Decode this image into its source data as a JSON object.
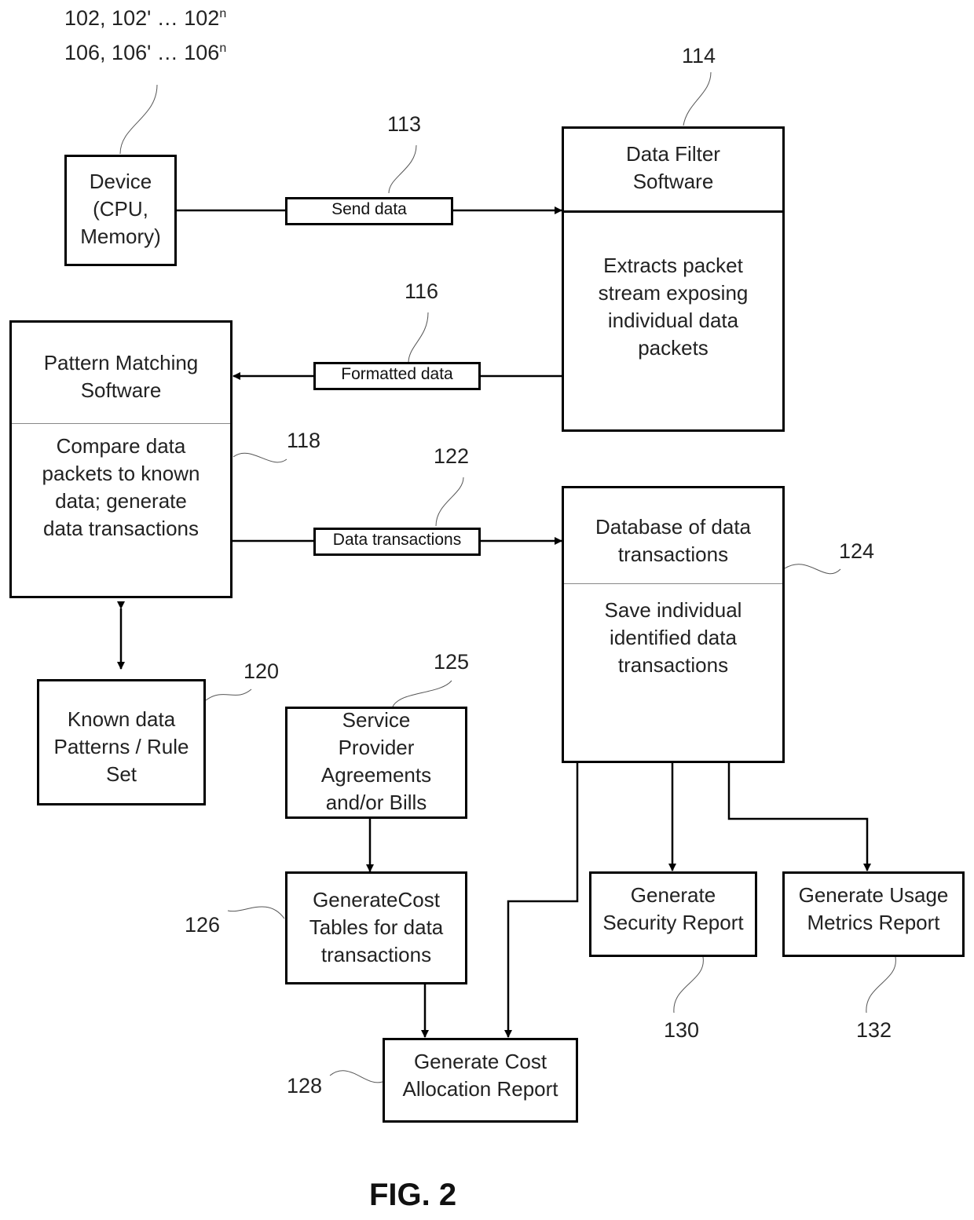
{
  "figure_label": "FIG. 2",
  "refs": {
    "devices_line1": "102, 102' … 102",
    "devices_line1_sup": "n",
    "devices_line2": "106, 106' … 106",
    "devices_line2_sup": "n",
    "r113": "113",
    "r114": "114",
    "r116": "116",
    "r118": "118",
    "r120": "120",
    "r122": "122",
    "r124": "124",
    "r125": "125",
    "r126": "126",
    "r128": "128",
    "r130": "130",
    "r132": "132"
  },
  "boxes": {
    "device": "Device\n(CPU,\nMemory)",
    "data_filter_title": "Data Filter\nSoftware",
    "data_filter_body": "Extracts packet\nstream exposing\nindividual data\npackets",
    "pattern_title": "Pattern Matching\nSoftware",
    "pattern_body": "Compare data\npackets to known\ndata; generate\ndata transactions",
    "database_title": "Database of data\ntransactions",
    "database_body": "Save individual\nidentified data\ntransactions",
    "known_patterns": "Known data\nPatterns / Rule\nSet",
    "service_provider": "Service\nProvider\nAgreements\nand/or Bills",
    "cost_tables": "GenerateCost\nTables for data\ntransactions",
    "cost_allocation": "Generate Cost\nAllocation Report",
    "security_report": "Generate\nSecurity Report",
    "usage_report": "Generate Usage\nMetrics Report"
  },
  "connectors": {
    "send_data": "Send data",
    "formatted_data": "Formatted data",
    "data_transactions": "Data transactions"
  }
}
